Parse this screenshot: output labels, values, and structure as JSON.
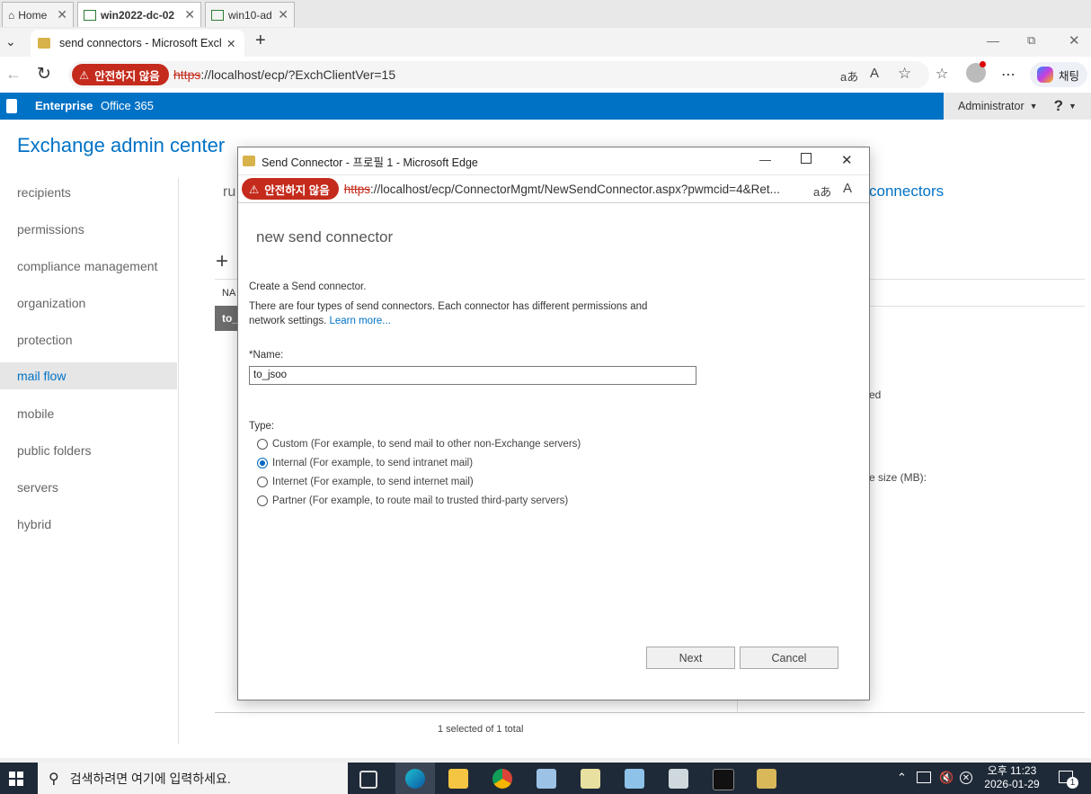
{
  "vm_tabs": [
    {
      "label": "Home"
    },
    {
      "label": "win2022-dc-02"
    },
    {
      "label": "win10-ad"
    }
  ],
  "browser": {
    "tab_title": "send connectors - Microsoft Exch",
    "not_secure_label": "안전하지 않음",
    "url_scheme": "https",
    "url_rest": "://localhost/ecp/?ExchClientVer=15",
    "chat_label": "채팅",
    "translate_glyph": "aあ",
    "read_aloud_glyph": "A",
    "more_glyph": "⋯"
  },
  "topnav": {
    "enterprise": "Enterprise",
    "office365": "Office 365",
    "user": "Administrator",
    "help": "?"
  },
  "eac": {
    "title": "Exchange admin center",
    "nav": [
      {
        "label": "recipients"
      },
      {
        "label": "permissions"
      },
      {
        "label": "compliance management"
      },
      {
        "label": "organization"
      },
      {
        "label": "protection"
      },
      {
        "label": "mail flow",
        "selected": true
      },
      {
        "label": "mobile"
      },
      {
        "label": "public folders"
      },
      {
        "label": "servers"
      },
      {
        "label": "hybrid"
      }
    ],
    "tab_partial": "ru",
    "tab_connectors": "connectors",
    "plus": "+",
    "col_partial": "NA",
    "row_partial": "to_",
    "detail_1": "ed",
    "detail_2": "e size (MB):",
    "footer": "1 selected of 1 total"
  },
  "popup": {
    "window_title": "Send Connector - 프로필 1 - Microsoft Edge",
    "not_secure_label": "안전하지 않음",
    "url_scheme": "https",
    "url_rest": "://localhost/ecp/ConnectorMgmt/NewSendConnector.aspx?pwmcid=4&Ret...",
    "heading": "new send connector",
    "intro": "Create a Send connector.",
    "desc1": "There are four types of send connectors. Each connector has different permissions and",
    "desc2": "network settings.",
    "learn_more": "Learn more...",
    "name_label": "*Name:",
    "name_value": "to_jsoo",
    "type_label": "Type:",
    "types": [
      {
        "label": "Custom (For example, to send mail to other non-Exchange servers)",
        "checked": false
      },
      {
        "label": "Internal (For example, to send intranet mail)",
        "checked": true
      },
      {
        "label": "Internet (For example, to send internet mail)",
        "checked": false
      },
      {
        "label": "Partner (For example, to route mail to trusted third-party servers)",
        "checked": false
      }
    ],
    "next_label": "Next",
    "cancel_label": "Cancel"
  },
  "taskbar": {
    "search_placeholder": "검색하려면 여기에 입력하세요.",
    "time": "오후 11:23",
    "date": "2026-01-29",
    "notif_count": "1"
  }
}
